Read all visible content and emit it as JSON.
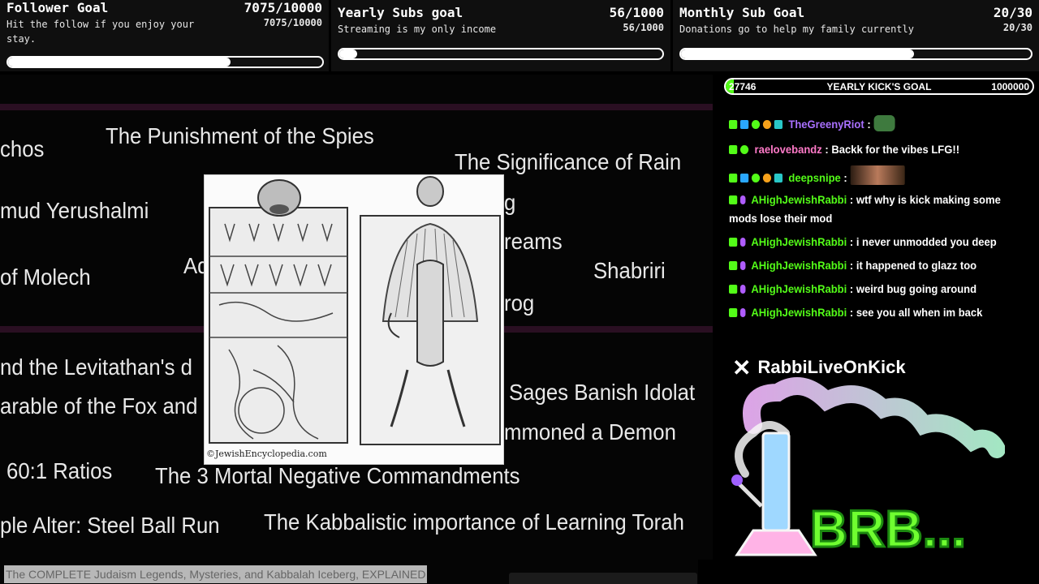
{
  "goals": [
    {
      "title": "Follower Goal",
      "count": "7075/10000",
      "desc": "Hit the follow if you enjoy your stay.",
      "subcount": "7075/10000",
      "progress": 0.7075
    },
    {
      "title": "Yearly Subs goal",
      "count": "56/1000",
      "desc": "Streaming is my only income",
      "subcount": "56/1000",
      "progress": 0.056
    },
    {
      "title": "Monthly Sub Goal",
      "count": "20/30",
      "desc": "Donations go to help my family currently",
      "subcount": "20/30",
      "progress": 0.667
    }
  ],
  "video": {
    "labels": [
      "chos",
      "The Punishment of the Spies",
      "The Significance of Rain",
      "mud Yerushalmi",
      "g",
      "reams",
      "of Molech",
      "Ad",
      "Shabriri",
      "rog",
      "nd the Levitathan's d",
      "Sages Banish Idolat",
      "arable of the Fox and",
      "mmoned a Demon",
      "60:1 Ratios",
      "The 3 Mortal Negative Commandments",
      "ple Alter: Steel Ball Run",
      "The Kabbalistic importance of Learning Torah"
    ],
    "image_credit": "©JewishEncyclopedia.com",
    "caption": "The COMPLETE Judaism Legends, Mysteries, and Kabbalah Iceberg, EXPLAINED"
  },
  "kick_goal": {
    "current": "27746",
    "title": "YEARLY KICK'S GOAL",
    "target": "1000000",
    "progress": 0.0277
  },
  "chat": [
    {
      "user": "TheGreenyRiot",
      "color": "purple",
      "badges": [
        "kick",
        "blue",
        "ok",
        "gold",
        "grid"
      ],
      "text": "",
      "emote": "pepe"
    },
    {
      "user": "raelovebandz",
      "color": "pink",
      "badges": [
        "kick",
        "ok"
      ],
      "text": "Backk for the vibes LFG!!"
    },
    {
      "user": "deepsnipe",
      "color": "green",
      "badges": [
        "kick",
        "blue",
        "ok",
        "gold",
        "grid"
      ],
      "text": "",
      "emote": "photo"
    },
    {
      "user": "AHighJewishRabbi",
      "color": "green",
      "badges": [
        "kick",
        "mod"
      ],
      "text": "wtf why is kick making some mods lose their mod"
    },
    {
      "user": "AHighJewishRabbi",
      "color": "green",
      "badges": [
        "kick",
        "mod"
      ],
      "text": "i never unmodded you deep"
    },
    {
      "user": "AHighJewishRabbi",
      "color": "green",
      "badges": [
        "kick",
        "mod"
      ],
      "text": "it happened to glazz too"
    },
    {
      "user": "AHighJewishRabbi",
      "color": "green",
      "badges": [
        "kick",
        "mod"
      ],
      "text": "weird bug going around"
    },
    {
      "user": "AHighJewishRabbi",
      "color": "green",
      "badges": [
        "kick",
        "mod"
      ],
      "text": "see you all when im back"
    }
  ],
  "social": {
    "handle": "RabbiLiveOnKick",
    "icon": "x-logo-icon"
  },
  "brb_text": "BRB..."
}
